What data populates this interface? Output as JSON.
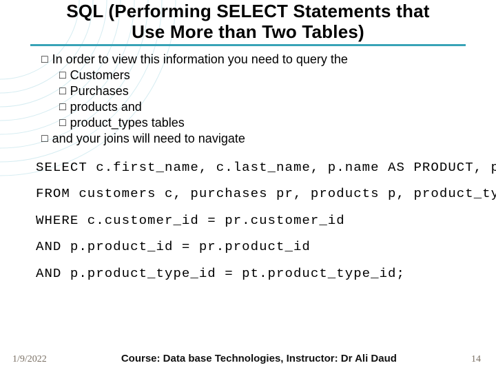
{
  "title_line1": "SQL (Performing SELECT Statements that",
  "title_line2": "Use More than Two Tables)",
  "bullets": {
    "intro": "In order to view this information you need to query the",
    "items": [
      "Customers",
      "Purchases",
      "products and",
      "product_types tables"
    ],
    "closing": "and your joins will need to navigate"
  },
  "sql": {
    "line1": "SELECT c.first_name, c.last_name, p.name AS PRODUCT, pt.name AS TYPE",
    "line2": "FROM customers c, purchases pr, products p, product_types pt",
    "line3": "WHERE c.customer_id = pr.customer_id",
    "line4": "AND p.product_id = pr.product_id",
    "line5": "AND p.product_type_id = pt.product_type_id;"
  },
  "footer": {
    "date": "1/9/2022",
    "course": "Course: Data base Technologies, Instructor: Dr Ali Daud",
    "page": "14"
  }
}
